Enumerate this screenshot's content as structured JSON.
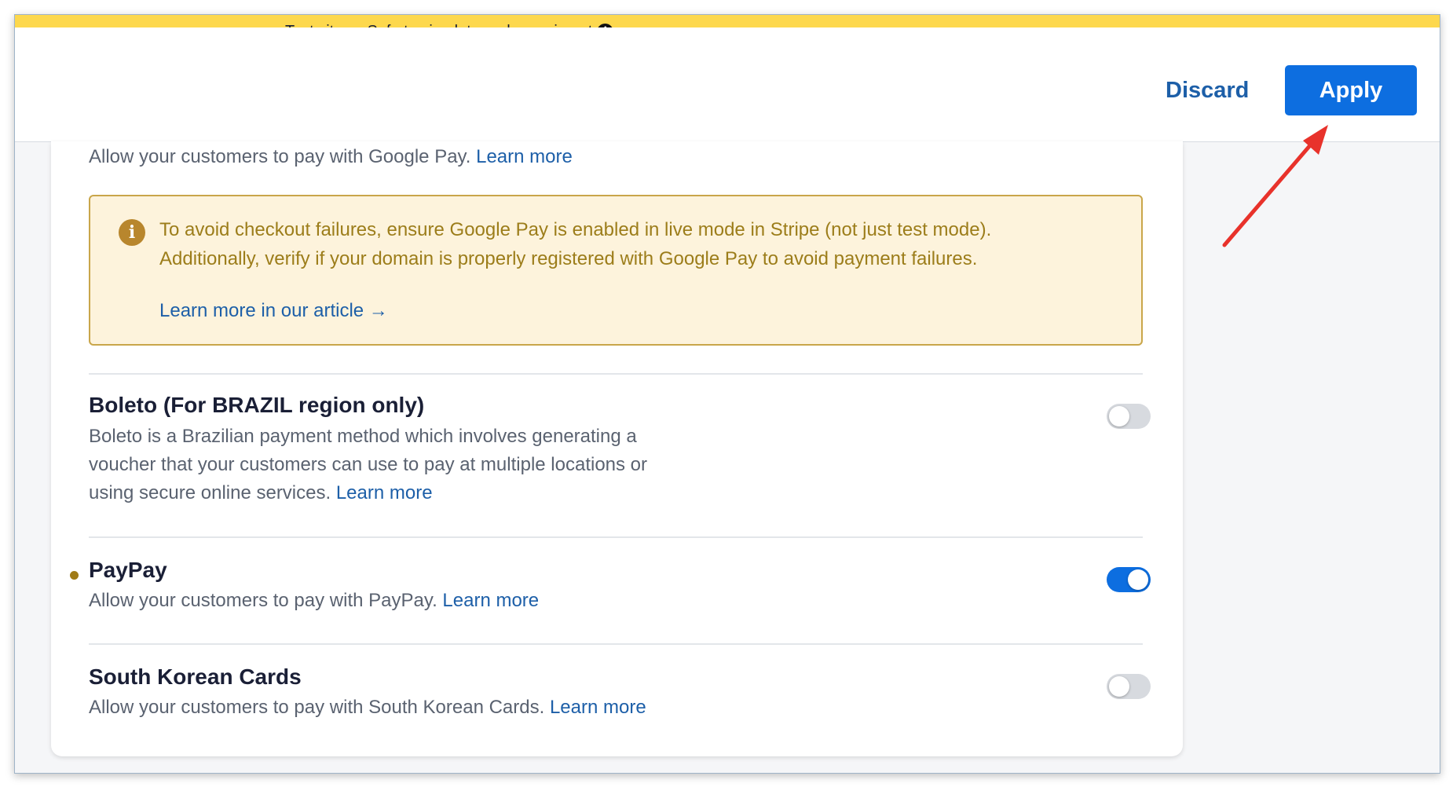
{
  "banner": {
    "text": "Test site — Safe to simulate and experiment",
    "icon": "info-icon"
  },
  "header": {
    "discard_label": "Discard",
    "apply_label": "Apply"
  },
  "google_pay": {
    "description": "Allow your customers to pay with Google Pay.",
    "link": "Learn more",
    "warning": {
      "icon": "info-icon",
      "line1": "To avoid checkout failures, ensure Google Pay is enabled in live mode in Stripe (not just test mode).",
      "line2": "Additionally, verify if your domain is properly registered with Google Pay to avoid payment failures.",
      "link": "Learn more in our article →"
    }
  },
  "methods": [
    {
      "title": "Boleto (For BRAZIL region only)",
      "description_lines": [
        "Boleto is a Brazilian payment method which involves generating a",
        "voucher that your customers can use to pay at multiple locations or",
        "using secure online services."
      ],
      "link": "Learn more",
      "enabled": false
    },
    {
      "title": "PayPay",
      "description": "Allow your customers to pay with PayPay.",
      "link": "Learn more",
      "enabled": true
    },
    {
      "title": "South Korean Cards",
      "description": "Allow your customers to pay with South Korean Cards.",
      "link": "Learn more",
      "enabled": false
    }
  ],
  "colors": {
    "banner": "#fdd84d",
    "primary": "#0d6ee0",
    "link": "#1d5fa8",
    "warning_bg": "#fdf3dc",
    "warning_text": "#9c7d1a",
    "annotation_arrow": "#e8322b"
  }
}
